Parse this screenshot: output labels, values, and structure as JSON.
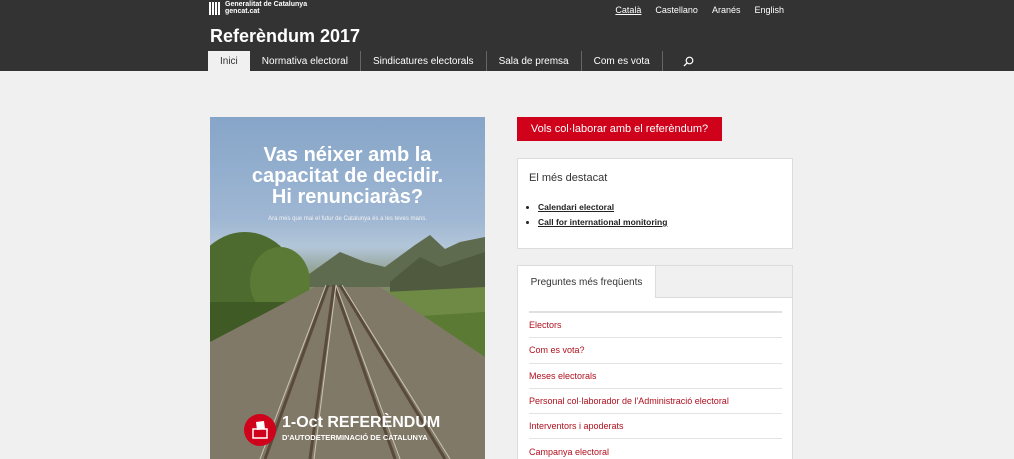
{
  "header": {
    "logo_line1": "Generalitat de Catalunya",
    "logo_line2": "gencat.cat",
    "site_title": "Referèndum 2017",
    "languages": [
      "Català",
      "Castellano",
      "Aranés",
      "English"
    ],
    "nav": [
      "Inici",
      "Normativa electoral",
      "Sindicatures electorals",
      "Sala de premsa",
      "Com es vota"
    ]
  },
  "poster": {
    "headline_1": "Vas néixer amb la",
    "headline_2": "capacitat de decidir.",
    "headline_3": "Hi renunciaràs?",
    "subline": "Ara més que mai el futur de Catalunya és a les teves mans.",
    "ref_title": "1-Oct REFERÈNDUM",
    "ref_subtitle": "D'AUTODETERMINACIÓ DE CATALUNYA"
  },
  "collab_button": "Vols col·laborar amb el referèndum?",
  "highlights": {
    "title": "El més destacat",
    "items": [
      "Calendari electoral",
      "Call for international monitoring"
    ]
  },
  "faq": {
    "tab": "Preguntes més freqüents",
    "items": [
      "Electors",
      "Com es vota?",
      "Meses electorals",
      "Personal col·laborador de l'Administració electoral",
      "Interventors i apoderats",
      "Campanya electoral"
    ]
  },
  "colors": {
    "header_bg": "#333333",
    "accent_red": "#d0021b",
    "link_red": "#b0101e",
    "page_bg": "#f0f0f0"
  }
}
